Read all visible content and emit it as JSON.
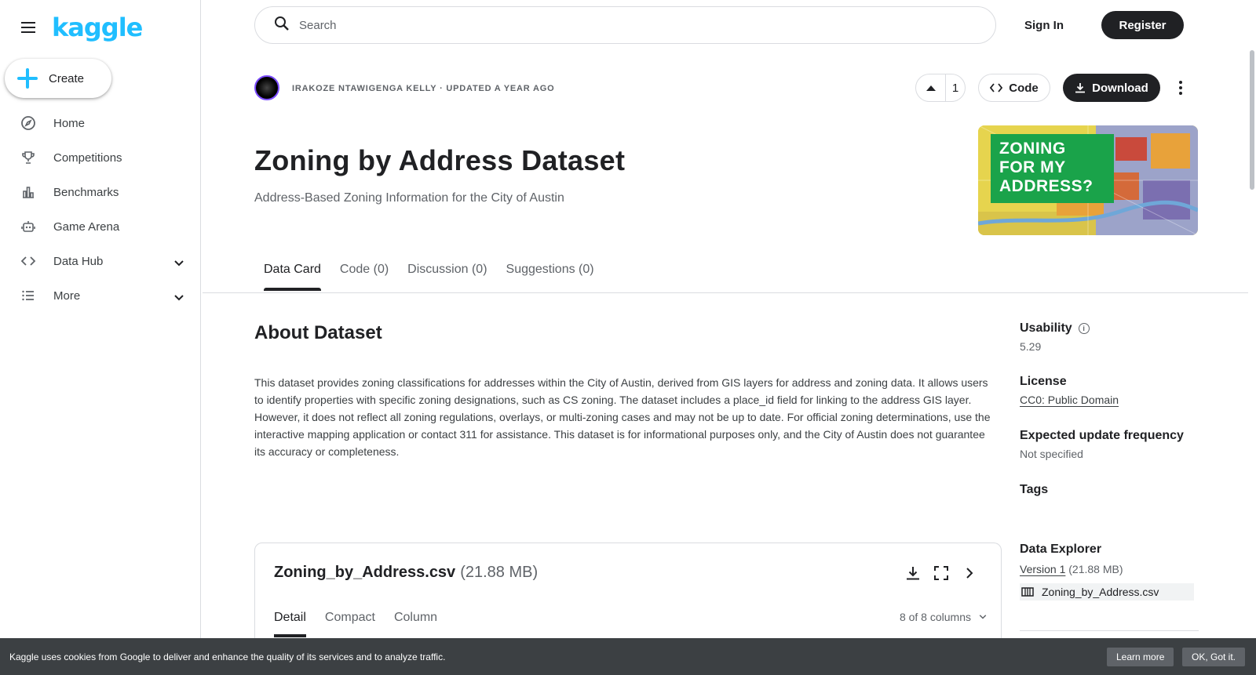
{
  "sidebar": {
    "logo": "kaggle",
    "create_label": "Create",
    "items": [
      {
        "label": "Home",
        "icon": "compass-icon"
      },
      {
        "label": "Competitions",
        "icon": "trophy-icon"
      },
      {
        "label": "Benchmarks",
        "icon": "bar-chart-icon"
      },
      {
        "label": "Game Arena",
        "icon": "robot-icon"
      },
      {
        "label": "Data Hub",
        "icon": "code-brackets-icon"
      },
      {
        "label": "More",
        "icon": "list-icon"
      }
    ]
  },
  "header": {
    "search_placeholder": "Search",
    "sign_in": "Sign In",
    "register": "Register"
  },
  "dataset": {
    "author_line": "IRAKOZE NTAWIGENGA KELLY · UPDATED A YEAR AGO",
    "vote_count": "1",
    "code_label": "Code",
    "download_label": "Download",
    "title": "Zoning by Address Dataset",
    "subtitle": "Address-Based Zoning Information for the City of Austin",
    "thumbnail_text": [
      "ZONING",
      "FOR MY",
      "ADDRESS?"
    ],
    "tabs": [
      "Data Card",
      "Code (0)",
      "Discussion (0)",
      "Suggestions (0)"
    ],
    "active_tab": "Data Card"
  },
  "about": {
    "heading": "About Dataset",
    "body": "This dataset provides zoning classifications for addresses within the City of Austin, derived from GIS layers for address and zoning data. It allows users to identify properties with specific zoning designations, such as CS zoning. The dataset includes a place_id field for linking to the address GIS layer. However, it does not reflect all zoning regulations, overlays, or multi-zoning cases and may not be up to date. For official zoning determinations, use the interactive mapping application or contact 311 for assistance. This dataset is for informational purposes only, and the City of Austin does not guarantee its accuracy or completeness."
  },
  "meta": {
    "usability_label": "Usability",
    "usability_value": "5.29",
    "license_label": "License",
    "license_value": "CC0: Public Domain",
    "frequency_label": "Expected update frequency",
    "frequency_value": "Not specified",
    "tags_label": "Tags",
    "explorer_label": "Data Explorer",
    "version_link": "Version 1",
    "version_size": "(21.88 MB)",
    "file_name": "Zoning_by_Address.csv"
  },
  "file_panel": {
    "file_name": "Zoning_by_Address.csv",
    "file_size": "(21.88 MB)",
    "tabs": [
      "Detail",
      "Compact",
      "Column"
    ],
    "columns_label": "8 of 8 columns"
  },
  "cookie": {
    "text": "Kaggle uses cookies from Google to deliver and enhance the quality of its services and to analyze traffic.",
    "learn_more": "Learn more",
    "ok": "OK, Got it."
  },
  "colors": {
    "brand": "#20beff",
    "dark": "#202124",
    "cookie_bg": "#3c4043"
  }
}
